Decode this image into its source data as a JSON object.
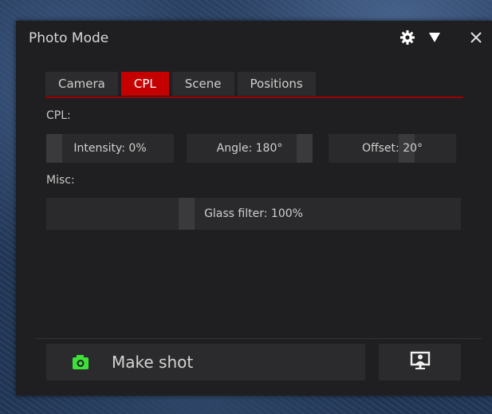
{
  "window": {
    "title": "Photo Mode"
  },
  "header": {
    "settings_icon": "gear-icon",
    "collapse_icon": "triangle-down-icon",
    "close_icon": "close-icon"
  },
  "tabs": [
    {
      "label": "Camera",
      "active": false
    },
    {
      "label": "CPL",
      "active": true
    },
    {
      "label": "Scene",
      "active": false
    },
    {
      "label": "Positions",
      "active": false
    }
  ],
  "cpl_section": {
    "label": "CPL:",
    "intensity": {
      "label": "Intensity: 0%",
      "value": 0
    },
    "angle": {
      "label": "Angle: 180°",
      "value": 180
    },
    "offset": {
      "label": "Offset: 20°",
      "value": 20
    }
  },
  "misc_section": {
    "label": "Misc:",
    "glass_filter": {
      "label": "Glass filter: 100%",
      "value": 100
    }
  },
  "footer": {
    "make_shot_label": "Make shot",
    "camera_icon": "camera-icon",
    "screen_icon": "monitor-person-icon"
  },
  "colors": {
    "accent": "#c40000",
    "camera_icon": "#3ee03a",
    "panel_bg": "#1f1f21"
  }
}
